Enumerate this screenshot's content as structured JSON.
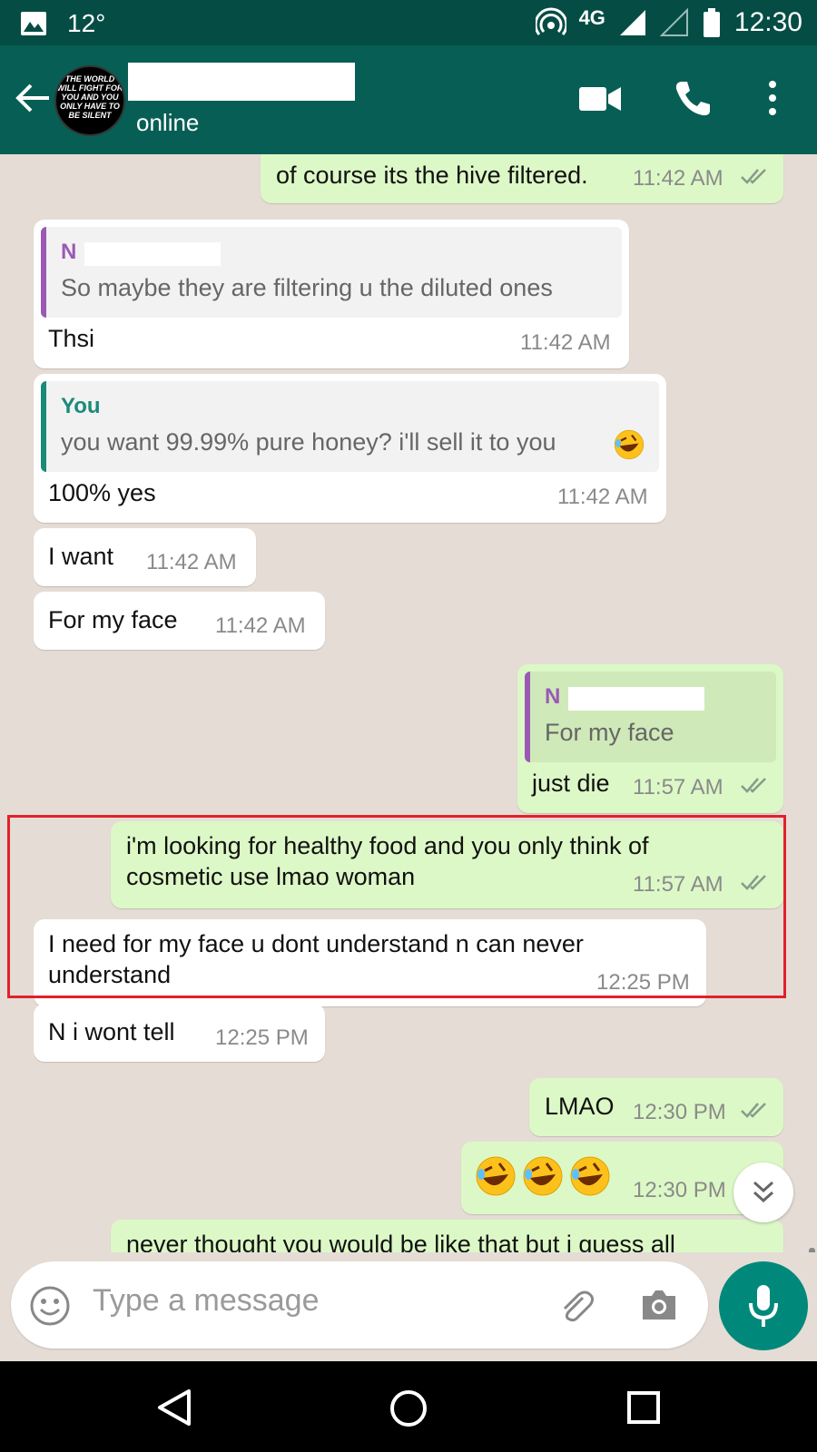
{
  "status_bar": {
    "temperature": "12°",
    "network": "4G",
    "time": "12:30"
  },
  "header": {
    "status": "online",
    "avatar_text": "THE WORLD WILL FIGHT FOR YOU AND YOU ONLY HAVE TO BE SILENT"
  },
  "messages": [
    {
      "text": "of course its the hive filtered.",
      "time": "11:42 AM"
    },
    {
      "quote_name": "N",
      "quote_text": "So maybe they are filtering u the diluted ones",
      "text": "Thsi",
      "time": "11:42 AM"
    },
    {
      "quote_name": "You",
      "quote_text": "you want 99.99% pure honey? i'll sell it to you",
      "text": "100% yes",
      "time": "11:42 AM"
    },
    {
      "text": "I want",
      "time": "11:42 AM"
    },
    {
      "text": "For my face",
      "time": "11:42 AM"
    },
    {
      "quote_name": "N",
      "quote_text": "For my face",
      "text": "just die",
      "time": "11:57 AM"
    },
    {
      "line1": "i'm looking for healthy food and you only think of",
      "line2": "cosmetic use lmao woman",
      "time": "11:57 AM"
    },
    {
      "line1": "I need for my face u dont understand n can never",
      "line2": "understand",
      "time": "12:25 PM"
    },
    {
      "text": "N i wont tell",
      "time": "12:25 PM"
    },
    {
      "text": "LMAO",
      "time": "12:30 PM"
    },
    {
      "text": "",
      "time": "12:30 PM"
    },
    {
      "text": "never thought you would be like that but i guess all"
    }
  ],
  "input": {
    "placeholder": "Type a message"
  },
  "colors": {
    "header": "#075e54",
    "status_bar": "#054d44",
    "outgoing": "#dcf8c6",
    "incoming": "#ffffff",
    "chat_bg": "#e5ddd5",
    "accent": "#00897b",
    "quote_you": "#1a8a7a",
    "quote_other": "#9b59b6",
    "highlight": "#e0212b"
  },
  "icons": [
    "image-icon",
    "hotspot-icon",
    "signal-icon",
    "battery-icon",
    "back-arrow-icon",
    "video-call-icon",
    "phone-icon",
    "more-options-icon",
    "read-ticks-icon",
    "scroll-down-icon",
    "emoji-icon",
    "attach-icon",
    "camera-icon",
    "mic-icon",
    "nav-back-icon",
    "nav-home-icon",
    "nav-recents-icon",
    "rolling-laughing-emoji"
  ]
}
